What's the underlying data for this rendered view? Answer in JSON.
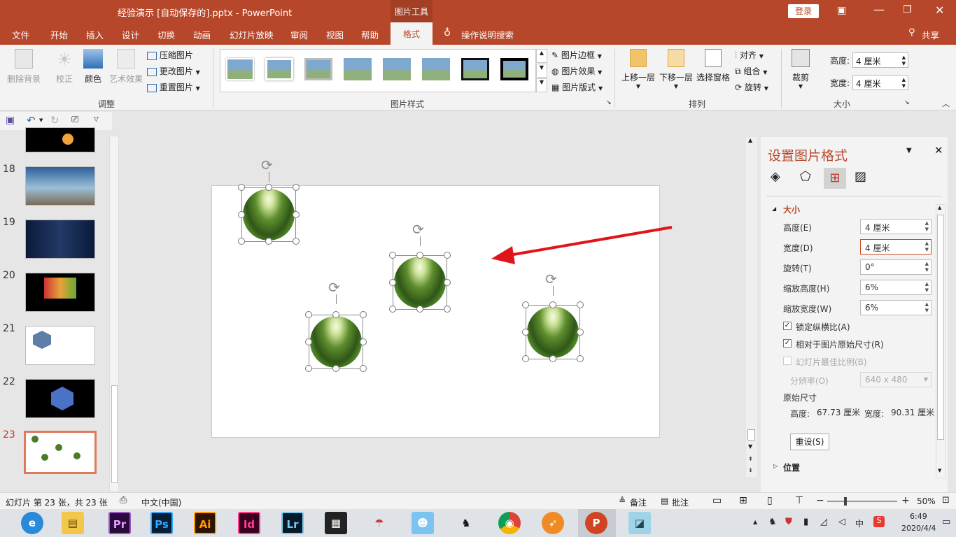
{
  "app": {
    "title": "经验演示 [自动保存的].pptx - PowerPoint",
    "context_tab": "图片工具",
    "login": "登录"
  },
  "menu": {
    "tabs": [
      "文件",
      "开始",
      "插入",
      "设计",
      "切换",
      "动画",
      "幻灯片放映",
      "审阅",
      "视图",
      "帮助",
      "格式"
    ],
    "active": "格式",
    "tell_me": "操作说明搜索",
    "share": "共享"
  },
  "ribbon": {
    "adjust": {
      "remove_bg": "删除背景",
      "correct": "校正",
      "color": "颜色",
      "art_effects": "艺术效果",
      "compress": "压缩图片",
      "change": "更改图片",
      "reset": "重置图片",
      "group_label": "调整"
    },
    "styles": {
      "border": "图片边框",
      "effects": "图片效果",
      "layout": "图片版式",
      "group_label": "图片样式"
    },
    "arrange": {
      "forward": "上移一层",
      "backward": "下移一层",
      "selection_pane": "选择窗格",
      "align": "对齐",
      "group": "组合",
      "rotate": "旋转",
      "group_label": "排列"
    },
    "size": {
      "crop": "裁剪",
      "height_label": "高度:",
      "height_value": "4 厘米",
      "width_label": "宽度:",
      "width_value": "4 厘米",
      "group_label": "大小"
    }
  },
  "thumbnails": {
    "numbers": [
      "18",
      "19",
      "20",
      "21",
      "22",
      "23"
    ],
    "active": "23"
  },
  "format_pane": {
    "title": "设置图片格式",
    "section_size": "大小",
    "fields": [
      {
        "label": "高度(E)",
        "value": "4 厘米"
      },
      {
        "label": "宽度(D)",
        "value": "4 厘米"
      },
      {
        "label": "旋转(T)",
        "value": "0°"
      },
      {
        "label": "缩放高度(H)",
        "value": "6%"
      },
      {
        "label": "缩放宽度(W)",
        "value": "6%"
      }
    ],
    "lock_ratio": "锁定纵横比(A)",
    "relative_original": "相对于图片原始尺寸(R)",
    "best_scale": "幻灯片最佳比例(B)",
    "resolution_label": "分辨率(O)",
    "resolution_value": "640 x 480",
    "original_size": "原始尺寸",
    "orig_height_label": "高度:",
    "orig_height_value": "67.73 厘米",
    "orig_width_label": "宽度:",
    "orig_width_value": "90.31 厘米",
    "reset_button": "重设(S)",
    "section_position": "位置"
  },
  "status": {
    "slide_info": "幻灯片 第 23 张，共 23 张",
    "language": "中文(中国)",
    "notes": "备注",
    "comments": "批注",
    "zoom": "50%"
  },
  "taskbar": {
    "apps": [
      "Pr",
      "Ps",
      "Ai",
      "Id",
      "Lr"
    ],
    "time": "6:49",
    "date": "2020/4/4",
    "ime": "中"
  },
  "colors": {
    "brand": "#b7472a",
    "accent": "#c0392b",
    "arrow": "#e0151b"
  }
}
